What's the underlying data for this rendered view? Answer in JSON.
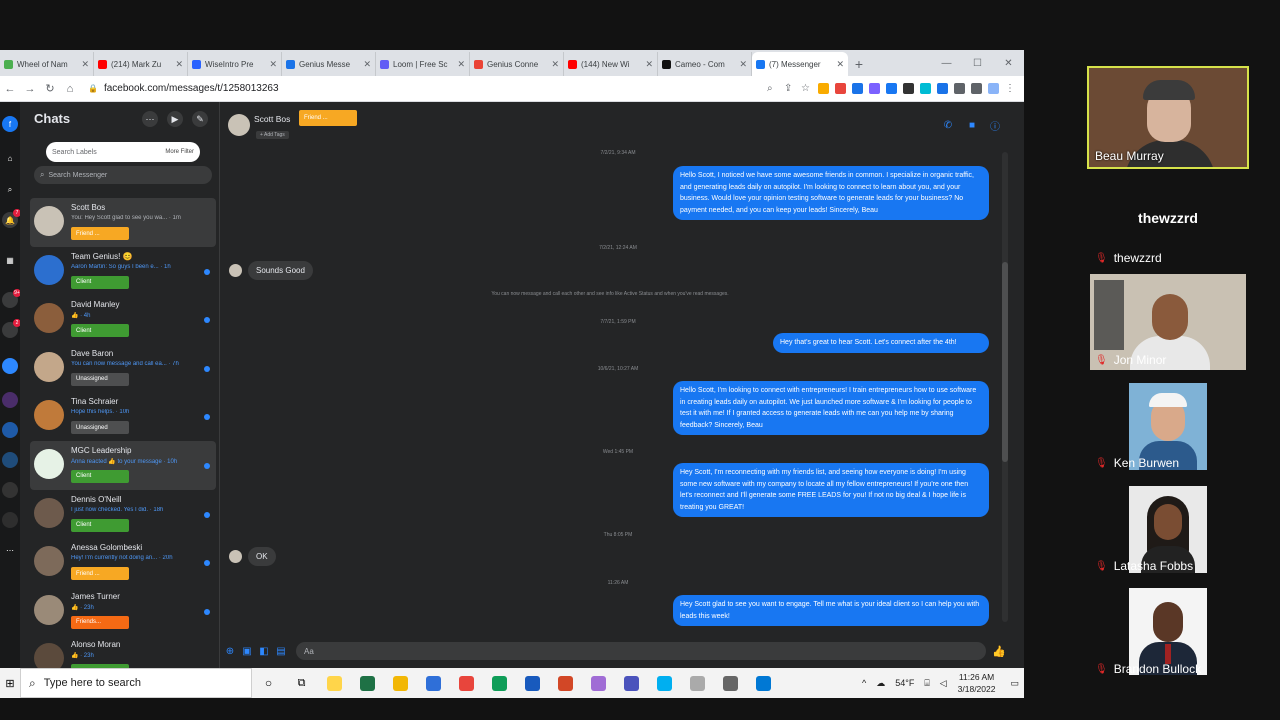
{
  "browser": {
    "tabs": [
      {
        "title": "Wheel of Nam",
        "color": "#4caf50",
        "active": false
      },
      {
        "title": "(214) Mark Zu",
        "color": "#ff0000",
        "active": false
      },
      {
        "title": "WiseIntro Pre",
        "color": "#2962ff",
        "active": false
      },
      {
        "title": "Genius Messe",
        "color": "#1a73e8",
        "active": false
      },
      {
        "title": "Loom | Free Sc",
        "color": "#625df5",
        "active": false
      },
      {
        "title": "Genius Conne",
        "color": "#ea4335",
        "active": false
      },
      {
        "title": "(144) New Wi",
        "color": "#ff0000",
        "active": false
      },
      {
        "title": "Cameo - Com",
        "color": "#111111",
        "active": false
      },
      {
        "title": "(7) Messenger",
        "color": "#1877f2",
        "active": true
      }
    ],
    "new_tab": "+",
    "window_controls": {
      "minimize": "—",
      "maximize": "☐",
      "close": "✕"
    },
    "url": "facebook.com/messages/t/1258013263"
  },
  "messenger": {
    "rail_badges": [
      "7",
      "9+",
      "2"
    ],
    "chats_title": "Chats",
    "label_search_placeholder": "Search Labels",
    "more_filter": "More Filter",
    "search_placeholder": "Search Messenger",
    "chats": [
      {
        "name": "Scott Bos",
        "preview": "You: Hey Scott glad to see you wa... · 1m",
        "tag": "Friend ...",
        "tag_color": "#f7a823",
        "avatar": "#c9c2b6",
        "selected": true,
        "unread": false,
        "preview_grey": true
      },
      {
        "name": "Team Genius! 😊",
        "preview": "Aaron Martin: So guys I been e... · 1h",
        "tag": "Client",
        "tag_color": "#3f9b32",
        "avatar": "#2c6fcf",
        "selected": false,
        "unread": true,
        "preview_grey": false
      },
      {
        "name": "David Manley",
        "preview": "👍 · 4h",
        "tag": "Client",
        "tag_color": "#3f9b32",
        "avatar": "#8b5e3c",
        "selected": false,
        "unread": true,
        "preview_grey": false
      },
      {
        "name": "Dave Baron",
        "preview": "You can now message and call ea... · 7h",
        "tag": "Unassigned",
        "tag_color": "#4e4f50",
        "avatar": "#c3a78a",
        "selected": false,
        "unread": true,
        "preview_grey": false
      },
      {
        "name": "Tina Schraier",
        "preview": "Hope this helps. · 10h",
        "tag": "Unassigned",
        "tag_color": "#4e4f50",
        "avatar": "#c07a3a",
        "selected": false,
        "unread": true,
        "preview_grey": false
      },
      {
        "name": "MGC Leadership",
        "preview": "Anna reacted 👍 to your message · 10h",
        "tag": "Client",
        "tag_color": "#3f9b32",
        "avatar": "#e6f2e6",
        "selected": true,
        "unread": true,
        "preview_grey": false
      },
      {
        "name": "Dennis O'Neill",
        "preview": "I just now checked. Yes I did. · 18h",
        "tag": "Client",
        "tag_color": "#3f9b32",
        "avatar": "#6d5a4c",
        "selected": false,
        "unread": true,
        "preview_grey": false
      },
      {
        "name": "Anessa Golombeski",
        "preview": "Hey! I'm currently not doing an... · 20h",
        "tag": "Friend ...",
        "tag_color": "#f7a823",
        "avatar": "#7d6a5a",
        "selected": false,
        "unread": true,
        "preview_grey": false
      },
      {
        "name": "James Turner",
        "preview": "👍 · 23h",
        "tag": "Friends...",
        "tag_color": "#f56a14",
        "avatar": "#9a8a78",
        "selected": false,
        "unread": true,
        "preview_grey": false
      },
      {
        "name": "Alonso Moran",
        "preview": "👍 · 23h",
        "tag": "",
        "tag_color": "#3f9b32",
        "avatar": "#5b4a3c",
        "selected": false,
        "unread": false,
        "preview_grey": false
      }
    ],
    "conversation": {
      "contact_name": "Scott Bos",
      "contact_tag": "Friend ...",
      "add_tags": "+ Add Tags",
      "messages": [
        {
          "type": "ts",
          "text": "7/2/21, 9:34 AM"
        },
        {
          "type": "out",
          "text": "Hello Scott, I noticed we have some awesome friends in common. I specialize in organic traffic, and generating leads daily on autopilot. I'm looking to connect to learn about you, and your business. Would love your opinion testing software to generate leads for your business? No payment needed, and you can keep your leads! Sincerely, Beau"
        },
        {
          "type": "ts",
          "text": "7/2/21, 12:24 AM"
        },
        {
          "type": "in",
          "text": "Sounds Good"
        },
        {
          "type": "sys",
          "text": "You can now message and call each other and see info like Active Status and when you've read messages."
        },
        {
          "type": "ts",
          "text": "7/7/21, 1:59 PM"
        },
        {
          "type": "out",
          "text": "Hey that's great to hear Scott. Let's connect after the 4th!"
        },
        {
          "type": "ts",
          "text": "10/6/21, 10:27 AM"
        },
        {
          "type": "out",
          "text": "Hello Scott, I'm looking to connect with entrepreneurs! I train entrepreneurs how to use software in creating leads daily on autopilot. We just launched more software & I'm looking for people to test it with me! If I granted access to generate leads with me can you help me by sharing feedback? Sincerely, Beau"
        },
        {
          "type": "ts",
          "text": "Wed 1:45 PM"
        },
        {
          "type": "out",
          "text": "Hey Scott, I'm reconnecting with my friends list, and seeing how everyone is doing! I'm using some new software with my company to locate all my fellow entrepreneurs! If you're one then let's reconnect and I'll generate some FREE LEADS for you! If not no big deal & I hope life is treating you GREAT!"
        },
        {
          "type": "ts",
          "text": "Thu 8:05 PM"
        },
        {
          "type": "in",
          "text": "OK"
        },
        {
          "type": "ts",
          "text": "11:26 AM"
        },
        {
          "type": "out",
          "text": "Hey Scott glad to see you want to engage. Tell me what is your ideal client so I can help you with leads this week!"
        }
      ],
      "composer_placeholder": "Aa"
    }
  },
  "taskbar": {
    "search_placeholder": "Type here to search",
    "apps": [
      "#ffd54a",
      "#1e7145",
      "#f2b705",
      "#2f6fd8",
      "#e8453c",
      "#0f9d58",
      "#185abd",
      "#d24726",
      "#a06cd5",
      "#4b53bc",
      "#00aff0",
      "#aaaaaa",
      "#666666",
      "#0078d4"
    ],
    "weather": "54°F",
    "time": "11:26 AM",
    "date": "3/18/2022"
  },
  "participants": {
    "host": "Beau Murray",
    "audio_only_title": "thewzzrd",
    "audio_only_name": "thewzzrd",
    "names": [
      "Jon Minor",
      "Ken Burwen",
      "Latasha Fobbs",
      "Brandon Bullock"
    ]
  }
}
